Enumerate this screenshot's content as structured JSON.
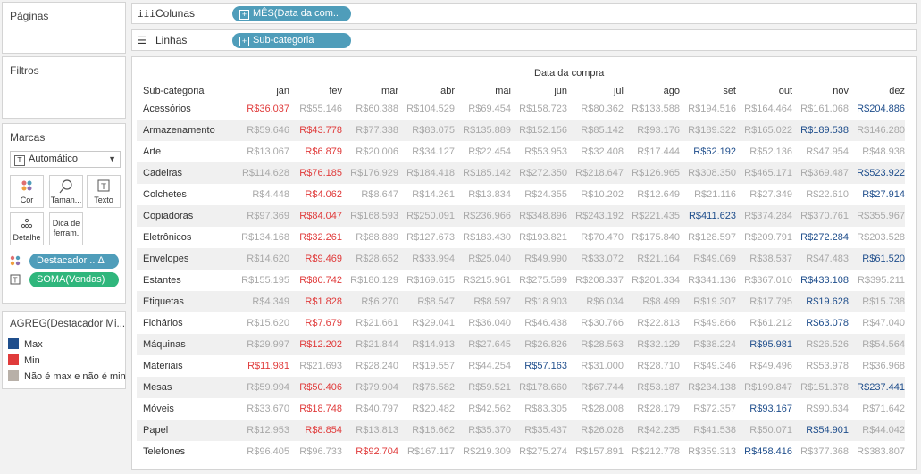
{
  "pages_panel": {
    "title": "Páginas"
  },
  "filters_panel": {
    "title": "Filtros"
  },
  "columns_shelf": {
    "label": "Colunas",
    "pill": "MÊS(Data da com.."
  },
  "rows_shelf": {
    "label": "Linhas",
    "pill": "Sub-categoria"
  },
  "marks": {
    "title": "Marcas",
    "type_dropdown": "Automático",
    "buttons": [
      {
        "label": "Cor",
        "icon": "color-icon"
      },
      {
        "label": "Taman...",
        "icon": "size-icon"
      },
      {
        "label": "Texto",
        "icon": "text-icon"
      },
      {
        "label": "Detalhe",
        "icon": "detail-icon"
      },
      {
        "label": "Dica de ferram.",
        "icon": "tooltip-icon"
      }
    ],
    "color_pill": "Destacador .. Δ",
    "text_pill": "SOMA(Vendas)",
    "color_pill_bg": "#4f9dba",
    "text_pill_bg": "#2fb67c"
  },
  "legend": {
    "title": "AGREG(Destacador Mi...",
    "items": [
      {
        "label": "Max",
        "color": "#1f4e8c"
      },
      {
        "label": "Min",
        "color": "#e03b3b"
      },
      {
        "label": "Não é max e não é min",
        "color": "#b8b0a8"
      }
    ]
  },
  "table": {
    "column_title": "Data da compra",
    "row_header": "Sub-categoria",
    "months": [
      "jan",
      "fev",
      "mar",
      "abr",
      "mai",
      "jun",
      "jul",
      "ago",
      "set",
      "out",
      "nov",
      "dez"
    ],
    "rows": [
      {
        "name": "Acessórios",
        "values": [
          "R$36.037",
          "R$55.146",
          "R$60.388",
          "R$104.529",
          "R$69.454",
          "R$158.723",
          "R$80.362",
          "R$133.588",
          "R$194.516",
          "R$164.464",
          "R$161.068",
          "R$204.886"
        ],
        "min": 0,
        "max": 11
      },
      {
        "name": "Armazenamento",
        "values": [
          "R$59.646",
          "R$43.778",
          "R$77.338",
          "R$83.075",
          "R$135.889",
          "R$152.156",
          "R$85.142",
          "R$93.176",
          "R$189.322",
          "R$165.022",
          "R$189.538",
          "R$146.280"
        ],
        "min": 1,
        "max": 10
      },
      {
        "name": "Arte",
        "values": [
          "R$13.067",
          "R$6.879",
          "R$20.006",
          "R$34.127",
          "R$22.454",
          "R$53.953",
          "R$32.408",
          "R$17.444",
          "R$62.192",
          "R$52.136",
          "R$47.954",
          "R$48.938"
        ],
        "min": 1,
        "max": 8
      },
      {
        "name": "Cadeiras",
        "values": [
          "R$114.628",
          "R$76.185",
          "R$176.929",
          "R$184.418",
          "R$185.142",
          "R$272.350",
          "R$218.647",
          "R$126.965",
          "R$308.350",
          "R$465.171",
          "R$369.487",
          "R$523.922"
        ],
        "min": 1,
        "max": 11
      },
      {
        "name": "Colchetes",
        "values": [
          "R$4.448",
          "R$4.062",
          "R$8.647",
          "R$14.261",
          "R$13.834",
          "R$24.355",
          "R$10.202",
          "R$12.649",
          "R$21.116",
          "R$27.349",
          "R$22.610",
          "R$27.914"
        ],
        "min": 1,
        "max": 11
      },
      {
        "name": "Copiadoras",
        "values": [
          "R$97.369",
          "R$84.047",
          "R$168.593",
          "R$250.091",
          "R$236.966",
          "R$348.896",
          "R$243.192",
          "R$221.435",
          "R$411.623",
          "R$374.284",
          "R$370.761",
          "R$355.967"
        ],
        "min": 1,
        "max": 8
      },
      {
        "name": "Eletrônicos",
        "values": [
          "R$134.168",
          "R$32.261",
          "R$88.889",
          "R$127.673",
          "R$183.430",
          "R$193.821",
          "R$70.470",
          "R$175.840",
          "R$128.597",
          "R$209.791",
          "R$272.284",
          "R$203.528"
        ],
        "min": 1,
        "max": 10
      },
      {
        "name": "Envelopes",
        "values": [
          "R$14.620",
          "R$9.469",
          "R$28.652",
          "R$33.994",
          "R$25.040",
          "R$49.990",
          "R$33.072",
          "R$21.164",
          "R$49.069",
          "R$38.537",
          "R$47.483",
          "R$61.520"
        ],
        "min": 1,
        "max": 11
      },
      {
        "name": "Estantes",
        "values": [
          "R$155.195",
          "R$80.742",
          "R$180.129",
          "R$169.615",
          "R$215.961",
          "R$275.599",
          "R$208.337",
          "R$201.334",
          "R$341.136",
          "R$367.010",
          "R$433.108",
          "R$395.211"
        ],
        "min": 1,
        "max": 10
      },
      {
        "name": "Etiquetas",
        "values": [
          "R$4.349",
          "R$1.828",
          "R$6.270",
          "R$8.547",
          "R$8.597",
          "R$18.903",
          "R$6.034",
          "R$8.499",
          "R$19.307",
          "R$17.795",
          "R$19.628",
          "R$15.738"
        ],
        "min": 1,
        "max": 10
      },
      {
        "name": "Fichários",
        "values": [
          "R$15.620",
          "R$7.679",
          "R$21.661",
          "R$29.041",
          "R$36.040",
          "R$46.438",
          "R$30.766",
          "R$22.813",
          "R$49.866",
          "R$61.212",
          "R$63.078",
          "R$47.040"
        ],
        "min": 1,
        "max": 10
      },
      {
        "name": "Máquinas",
        "values": [
          "R$29.997",
          "R$12.202",
          "R$21.844",
          "R$14.913",
          "R$27.645",
          "R$26.826",
          "R$28.563",
          "R$32.129",
          "R$38.224",
          "R$95.981",
          "R$26.526",
          "R$54.564"
        ],
        "min": 1,
        "max": 9
      },
      {
        "name": "Materiais",
        "values": [
          "R$11.981",
          "R$21.693",
          "R$28.240",
          "R$19.557",
          "R$44.254",
          "R$57.163",
          "R$31.000",
          "R$28.710",
          "R$49.346",
          "R$49.496",
          "R$53.978",
          "R$36.968"
        ],
        "min": 0,
        "max": 5
      },
      {
        "name": "Mesas",
        "values": [
          "R$59.994",
          "R$50.406",
          "R$79.904",
          "R$76.582",
          "R$59.521",
          "R$178.660",
          "R$67.744",
          "R$53.187",
          "R$234.138",
          "R$199.847",
          "R$151.378",
          "R$237.441"
        ],
        "min": 1,
        "max": 11
      },
      {
        "name": "Móveis",
        "values": [
          "R$33.670",
          "R$18.748",
          "R$40.797",
          "R$20.482",
          "R$42.562",
          "R$83.305",
          "R$28.008",
          "R$28.179",
          "R$72.357",
          "R$93.167",
          "R$90.634",
          "R$71.642"
        ],
        "min": 1,
        "max": 9
      },
      {
        "name": "Papel",
        "values": [
          "R$12.953",
          "R$8.854",
          "R$13.813",
          "R$16.662",
          "R$35.370",
          "R$35.437",
          "R$26.028",
          "R$42.235",
          "R$41.538",
          "R$50.071",
          "R$54.901",
          "R$44.042"
        ],
        "min": 1,
        "max": 10
      },
      {
        "name": "Telefones",
        "values": [
          "R$96.405",
          "R$96.733",
          "R$92.704",
          "R$167.117",
          "R$219.309",
          "R$275.274",
          "R$157.891",
          "R$212.778",
          "R$359.313",
          "R$458.416",
          "R$377.368",
          "R$383.807"
        ],
        "min": 2,
        "max": 9
      }
    ]
  }
}
